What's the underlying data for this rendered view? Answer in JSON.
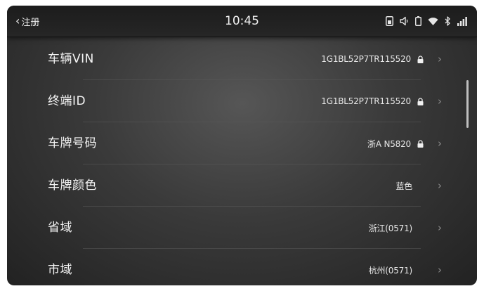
{
  "header": {
    "back_label": "注册",
    "time": "10:45"
  },
  "status_icons": [
    "sim-card-icon",
    "speaker-icon",
    "battery-icon",
    "wifi-icon",
    "bluetooth-icon",
    "signal-bars-icon"
  ],
  "rows": [
    {
      "label": "车辆VIN",
      "value": "1G1BL52P7TR115520",
      "locked": true
    },
    {
      "label": "终端ID",
      "value": "1G1BL52P7TR115520",
      "locked": true
    },
    {
      "label": "车牌号码",
      "value": "浙A N5820",
      "locked": true
    },
    {
      "label": "车牌颜色",
      "value": "蓝色",
      "locked": false
    },
    {
      "label": "省域",
      "value": "浙江(0571)",
      "locked": false
    },
    {
      "label": "市域",
      "value": "杭州(0571)",
      "locked": false
    }
  ],
  "colors": {
    "text": "#f4f4f4",
    "background": "#3a3a3a",
    "arrow": "#8a8a8a"
  }
}
